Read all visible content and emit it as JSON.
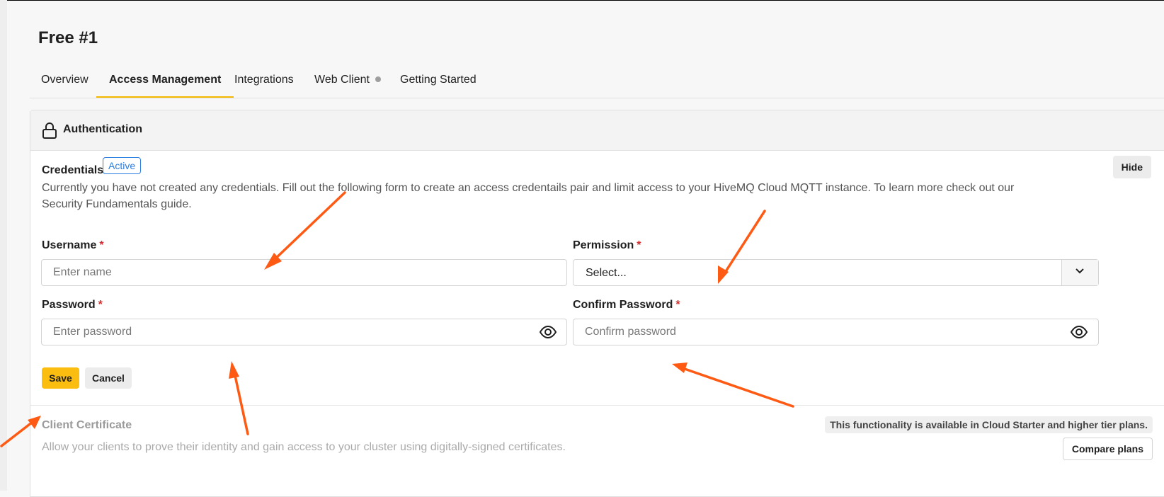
{
  "page": {
    "title": "Free #1"
  },
  "tabs": [
    {
      "label": "Overview"
    },
    {
      "label": "Access Management"
    },
    {
      "label": "Integrations"
    },
    {
      "label": "Web Client"
    },
    {
      "label": "Getting Started"
    }
  ],
  "active_tab": "Access Management",
  "panel": {
    "title": "Authentication",
    "icon": "lock-icon"
  },
  "credentials": {
    "title": "Credentials",
    "badge": "Active",
    "hide_label": "Hide",
    "description": "Currently you have not created any credentials. Fill out the following form to create an access credentails pair and limit access to your HiveMQ Cloud MQTT instance. To learn more check out our Security Fundamentals guide."
  },
  "form": {
    "required_mark": "*",
    "username": {
      "label": "Username",
      "placeholder": "Enter name",
      "value": ""
    },
    "permission": {
      "label": "Permission",
      "selected": "Select..."
    },
    "password": {
      "label": "Password",
      "placeholder": "Enter password",
      "value": ""
    },
    "confirm_password": {
      "label": "Confirm Password",
      "placeholder": "Confirm password",
      "value": ""
    },
    "save_label": "Save",
    "cancel_label": "Cancel"
  },
  "client_certificate": {
    "title": "Client Certificate",
    "description": "Allow your clients to prove their identity and gain access to your cluster using digitally-signed certificates.",
    "availability": "This functionality is available in Cloud Starter and higher tier plans.",
    "compare_label": "Compare plans"
  },
  "colors": {
    "accent": "#fbbd0f",
    "badge": "#2a7de1",
    "required": "#d32f2f",
    "annotation_arrow": "#ff5a14"
  }
}
